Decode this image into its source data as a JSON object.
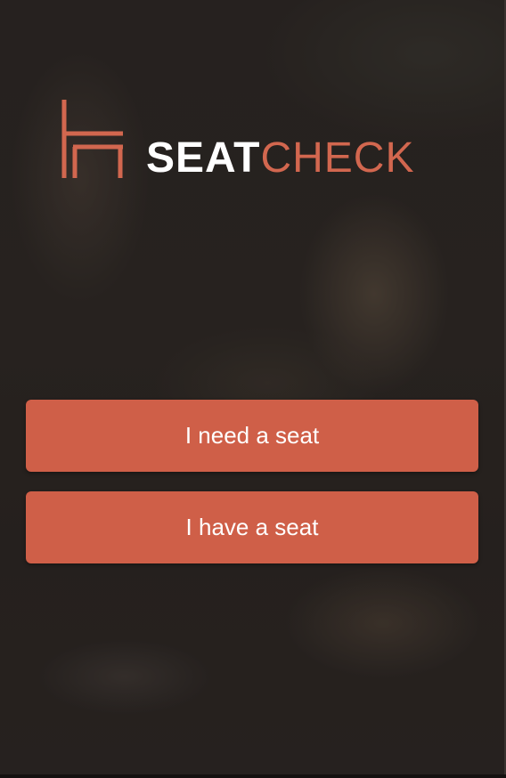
{
  "brand": {
    "wordmark_bold": "SEAT",
    "wordmark_light": "CHECK",
    "logo_icon": "chair-logo-icon",
    "accent_color": "#cf5f48",
    "logo_color": "#d2674f"
  },
  "actions": {
    "need_seat_label": "I need a seat",
    "have_seat_label": "I have a seat"
  }
}
